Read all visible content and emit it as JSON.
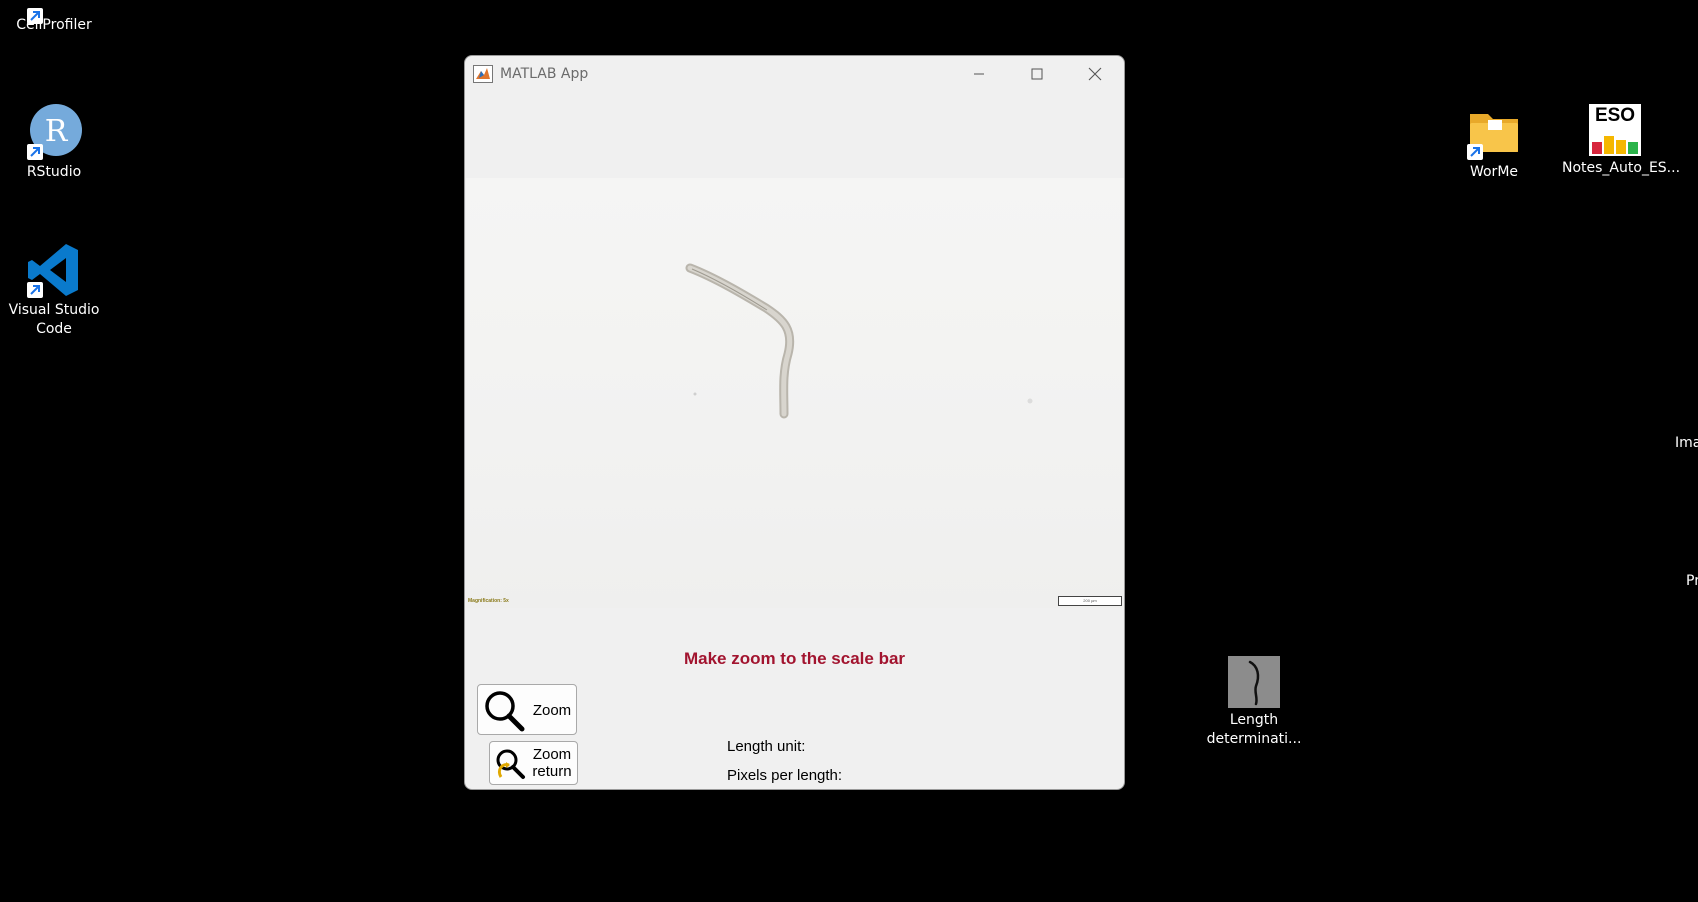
{
  "desktop": {
    "left_icons": [
      {
        "label": "CellProfiler",
        "icon": "cellprofiler-icon"
      },
      {
        "label": "RStudio",
        "icon": "rstudio-icon"
      },
      {
        "label_line1": "Visual Studio",
        "label_line2": "Code",
        "icon": "vscode-icon"
      }
    ],
    "right_icons": [
      {
        "label": "WorMe",
        "icon": "folder-icon"
      },
      {
        "label": "Notes_Auto_ES...",
        "icon": "eso-icon",
        "badge": "ESO"
      },
      {
        "label_line1": "Length",
        "label_line2": "determinati...",
        "icon": "worm-thumbnail-icon"
      }
    ],
    "edge_labels": [
      "Ima",
      "Pr"
    ],
    "rstudio_letter": "R"
  },
  "window": {
    "title": "MATLAB App",
    "controls": [
      "minimize",
      "maximize",
      "close"
    ],
    "image_overlay_left": "Magnification: 5x",
    "image_overlay_scale": "200 µm",
    "message": "Make zoom to the scale bar",
    "buttons": {
      "zoom": "Zoom",
      "zoom_return_line1": "Zoom",
      "zoom_return_line2": "return"
    },
    "fields": {
      "length_unit": "Length unit:",
      "pixels_per_length": "Pixels per length:"
    }
  },
  "colors": {
    "message": "#a2142f",
    "desktop_bg": "#000000",
    "window_bg": "#f0f0f0",
    "vscode": "#0a7acc",
    "rstudio": "#75aadb",
    "folder": "#f8c54a"
  }
}
